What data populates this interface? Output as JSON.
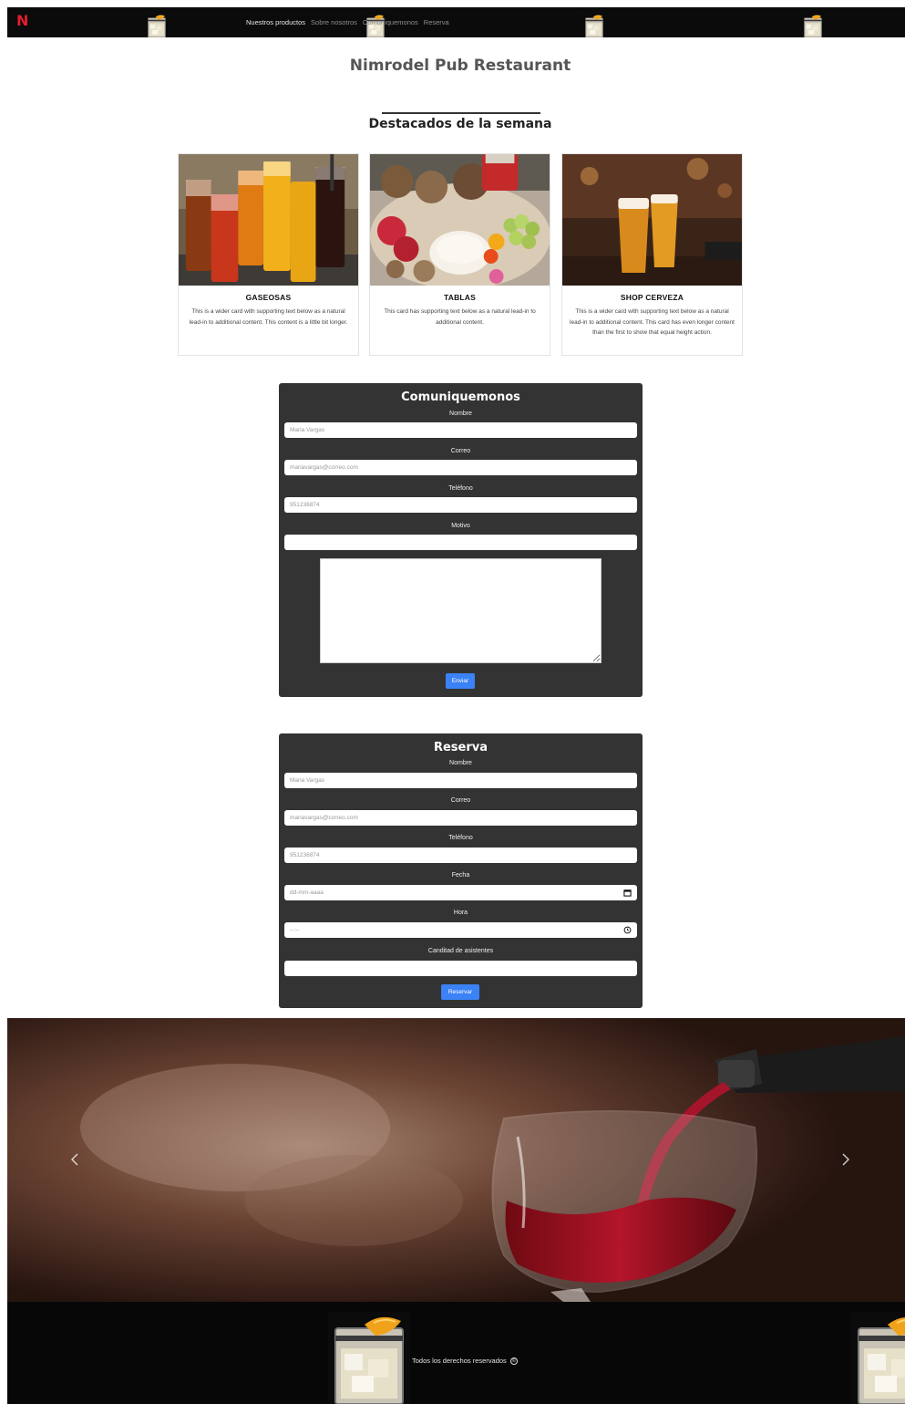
{
  "navbar": {
    "brand": "N",
    "links": [
      {
        "label": "Nuestros productos"
      },
      {
        "label": "Sobre nosotros"
      },
      {
        "label": "Comuniquemonos"
      },
      {
        "label": "Reserva"
      }
    ]
  },
  "header": {
    "site_title": "Nimrodel Pub Restaurant",
    "section_title": "Destacados de la semana"
  },
  "cards": [
    {
      "title": "GASEOSAS",
      "text": "This is a wider card with supporting text below as a natural lead-in to additional content. This content is a little bit longer.",
      "image": "soda-drinks-photo"
    },
    {
      "title": "TABLAS",
      "text": "This card has supporting text below as a natural lead-in to additional content.",
      "image": "cheese-board-photo"
    },
    {
      "title": "SHOP CERVEZA",
      "text": "This is a wider card with supporting text below as a natural lead-in to additional content. This card has even longer content than the first to show that equal height action.",
      "image": "beer-glasses-photo"
    }
  ],
  "contact_form": {
    "title": "Comuniquemonos",
    "name_label": "Nombre",
    "name_placeholder": "Maria Vargas",
    "email_label": "Correo",
    "email_placeholder": "mariavargas@correo.com",
    "phone_label": "Teléfono",
    "phone_placeholder": "951236874",
    "reason_label": "Motivo",
    "reason_value": "",
    "message_value": "",
    "submit_label": "Enviar"
  },
  "reservation_form": {
    "title": "Reserva",
    "name_label": "Nombre",
    "name_placeholder": "Maria Vargas",
    "email_label": "Correo",
    "email_placeholder": "mariavargas@correo.com",
    "phone_label": "Teléfono",
    "phone_placeholder": "951236874",
    "date_label": "Fecha",
    "date_placeholder": "dd-mm-aaaa",
    "time_label": "Hora",
    "time_placeholder": "--:--",
    "guests_label": "Canditad de asistentes",
    "guests_value": "",
    "submit_label": "Reservar"
  },
  "carousel": {
    "image": "red-wine-pour-photo",
    "prev_icon": "chevron-left-icon",
    "next_icon": "chevron-right-icon"
  },
  "footer": {
    "text": "Todos los derechos reservados",
    "icon": "copyright-icon"
  },
  "colors": {
    "navbar_bg": "#0b0b0b",
    "brand": "#e11d2f",
    "form_bg": "#333333",
    "button": "#3b82f6",
    "footer_bg": "#070707"
  }
}
